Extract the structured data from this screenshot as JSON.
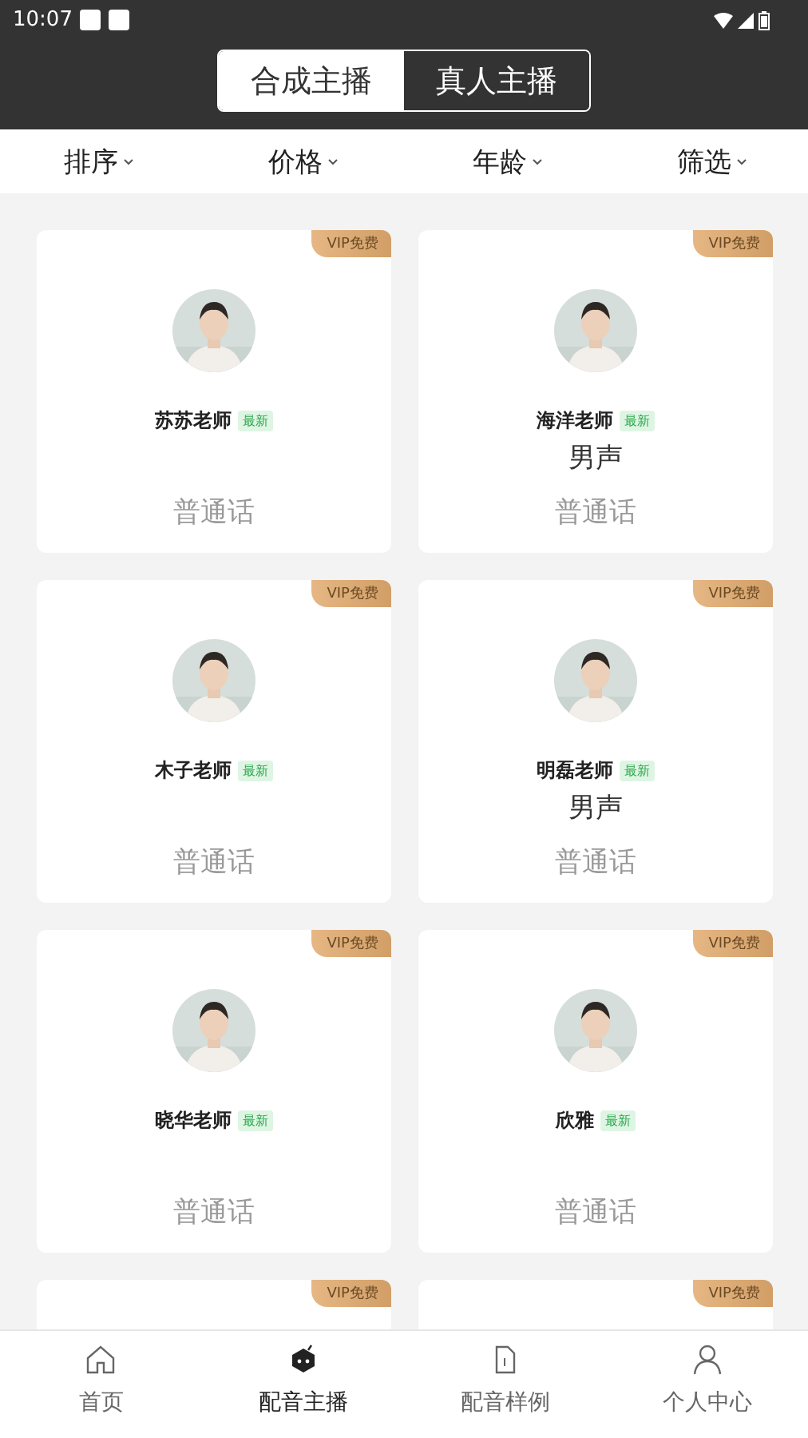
{
  "status_bar": {
    "time": "10:07"
  },
  "tabs": [
    {
      "label": "合成主播",
      "selected": true
    },
    {
      "label": "真人主播",
      "selected": false
    }
  ],
  "filters": [
    {
      "label": "排序"
    },
    {
      "label": "价格"
    },
    {
      "label": "年龄"
    },
    {
      "label": "筛选"
    }
  ],
  "cards": [
    {
      "badge": "VIP免费",
      "name": "苏苏老师",
      "tag": "最新",
      "language": "普通话"
    },
    {
      "badge": "VIP免费",
      "name": "海洋老师",
      "tag": "最新",
      "gender": "男声",
      "language": "普通话"
    },
    {
      "badge": "VIP免费",
      "name": "木子老师",
      "tag": "最新",
      "language": "普通话"
    },
    {
      "badge": "VIP免费",
      "name": "明磊老师",
      "tag": "最新",
      "gender": "男声",
      "language": "普通话"
    },
    {
      "badge": "VIP免费",
      "name": "晓华老师",
      "tag": "最新",
      "language": "普通话"
    },
    {
      "badge": "VIP免费",
      "name": "欣雅",
      "tag": "最新",
      "language": "普通话"
    },
    {
      "badge": "VIP免费"
    },
    {
      "badge": "VIP免费"
    }
  ],
  "nav": [
    {
      "label": "首页",
      "selected": false
    },
    {
      "label": "配音主播",
      "selected": true
    },
    {
      "label": "配音样例",
      "selected": false
    },
    {
      "label": "个人中心",
      "selected": false
    }
  ]
}
